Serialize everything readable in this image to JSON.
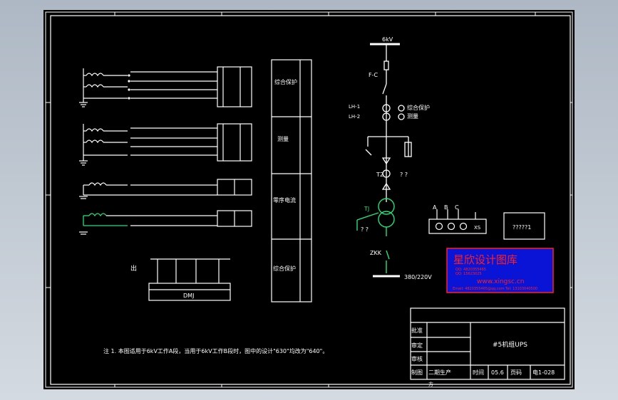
{
  "drawing": {
    "bus_top_label": "6kV",
    "fc_label": "F-C",
    "ct1_label": "LH-1",
    "ct2_label": "LH-2",
    "prot_label": "综合保护",
    "meas_label": "测量",
    "t2_label": "T2",
    "qmarks": "? ?",
    "tj_label": "TJ",
    "zkk_label": "ZKK",
    "bus_bottom_label": "380/220V",
    "phases": [
      "A",
      "B",
      "C"
    ],
    "xs_label": "XS",
    "box_label": "?????1",
    "dmj_label": "DMJ",
    "aux_label": "出",
    "right_panel": [
      "综合保护",
      "测量",
      "零序电流",
      "综合保护"
    ],
    "note": "注 1. 本图适用于6kV工作A段，当用于6kV工作B段时，图中的设计\"630\"均改为\"640\"。"
  },
  "stamp": {
    "title": "星欣设计图库",
    "qq1": "QQ: 4820355465",
    "qq2": "QQ: 15623025",
    "url": "www.xingsc.cn",
    "email": "Email: 4820355465@qq.com  Tel: 13103040500"
  },
  "titleblock": {
    "approve": "批准",
    "review": "审定",
    "check": "审核",
    "draw": "制图",
    "draw_value": "二期生产",
    "title": "#5机组UPS",
    "time_label": "时间",
    "time_value": "05.6",
    "page_label": "页码",
    "page_value": "电1-028",
    "sub": "方"
  },
  "colors": {
    "stroke": "#ffffff",
    "green": "#22e07a",
    "red": "#ff2020",
    "stamp_blue": "#0a14d6"
  }
}
